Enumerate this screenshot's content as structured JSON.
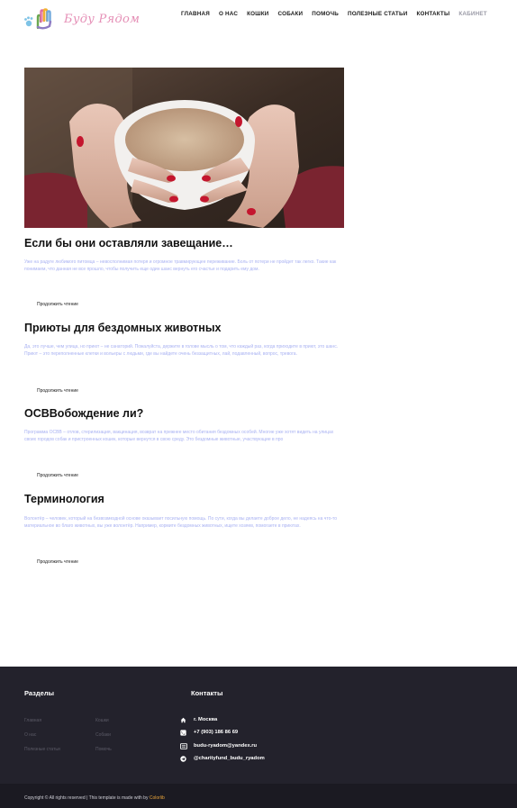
{
  "header": {
    "logo_text": "Буду Рядом",
    "nav": [
      "ГЛАВНАЯ",
      "О НАС",
      "КОШКИ",
      "СОБАКИ",
      "ПОМОЧЬ",
      "ПОЛЕЗНЫЕ СТАТЬИ",
      "КОНТАКТЫ",
      "КАБИНЕТ"
    ]
  },
  "posts": [
    {
      "title": "Если бы они оставляли завещание…",
      "excerpt": "Уже на радуге любимого питомца – невосполнимая потеря и огромное травмирующее переживание. Боль от потери не пройдет так легко. Такие как понимаем, что данная не все прошло, чтобы получить еще один шанс вернуть его счастье и подарить ему дом.",
      "read_more": "Продолжить чтение"
    },
    {
      "title": "Приюты для бездомных животных",
      "excerpt": "Да, это лучше, чем улица, но приют – не санаторий. Пожалуйста, держите в голове мысль о том, что каждый раз, когда приходите в приют, это шанс. Приют – это переполненные клетки и вольеры с людьми, где вы найдете очень беззащитных, лай, подавленный, вопрос, тревога.",
      "read_more": "Продолжить чтение"
    },
    {
      "title": "ОСВВобождение ли?",
      "excerpt": "Программа ОСВВ – отлов, стерилизация, вакцинация, возврат на прежнее место обитания бездомных особей. Многие уже хотят видеть на улицах своих городов собак и пристроенных кошек, которые вернутся в свою среду. Это бездомные животные, участвующие в про",
      "read_more": "Продолжить чтение"
    },
    {
      "title": "Терминология",
      "excerpt": "Волонтёр – человек, который на безвозмездной основе оказывает посильную помощь. По сути, когда вы делаете доброе дело, не надеясь на что-то материальное во благо животных, вы уже волонтёр. Например, кормите бездомных животных, ищете хозяев, помогаете в приютах.",
      "read_more": "Продолжить чтение"
    }
  ],
  "footer": {
    "sections_title": "Разделы",
    "contacts_title": "Контакты",
    "links_col1": [
      "Главная",
      "О нас",
      "Полезные статьи"
    ],
    "links_col2": [
      "Кошки",
      "Собаки",
      "Помочь"
    ],
    "contacts": [
      {
        "icon": "home-icon",
        "text": "г. Москва"
      },
      {
        "icon": "phone-icon",
        "text": "+7 (903) 186 86 69"
      },
      {
        "icon": "email-icon",
        "text": "budu-ryadom@yandex.ru"
      },
      {
        "icon": "telegram-icon",
        "text": "@charityfund_budu_ryadom"
      }
    ],
    "copyright_prefix": "Copyright © All rights reserved | This template is made with by ",
    "copyright_brand": "Colorlib"
  }
}
